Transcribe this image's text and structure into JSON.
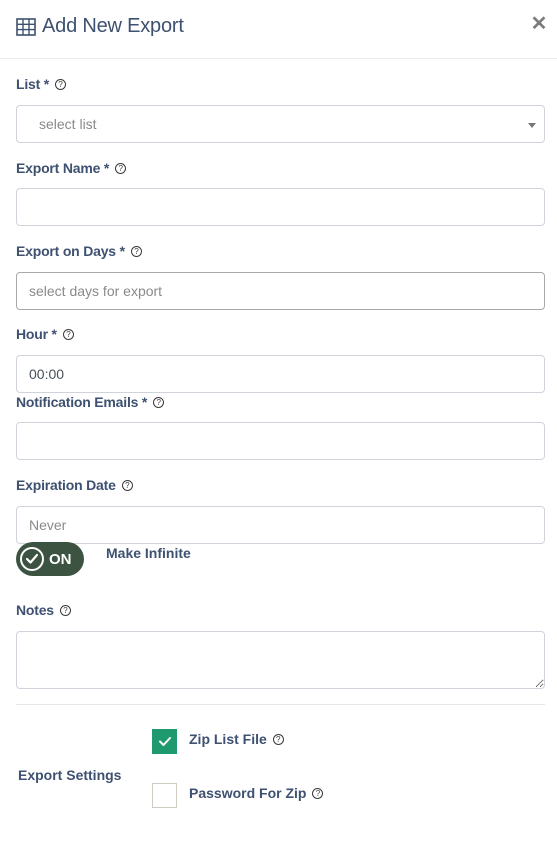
{
  "header": {
    "title": "Add New Export",
    "title_icon": "table-icon",
    "close_icon": "close-icon",
    "close_glyph": "✕"
  },
  "help_glyph": "?",
  "fields": {
    "list": {
      "label": "List *",
      "placeholder": "select list",
      "value": ""
    },
    "export_name": {
      "label": "Export Name *",
      "placeholder": "",
      "value": ""
    },
    "export_days": {
      "label": "Export on Days *",
      "placeholder": "select days for export",
      "value": ""
    },
    "hour": {
      "label": "Hour *",
      "value": "00:00"
    },
    "notification_emails": {
      "label": "Notification Emails *",
      "placeholder": "",
      "value": ""
    },
    "expiration_date": {
      "label": "Expiration Date",
      "placeholder": "Never",
      "value": ""
    },
    "make_infinite": {
      "toggle_text": "ON",
      "label": "Make Infinite",
      "state": "on"
    },
    "notes": {
      "label": "Notes",
      "value": ""
    }
  },
  "export_settings": {
    "label": "Export Settings",
    "options": [
      {
        "label": "Zip List File",
        "checked": true
      },
      {
        "label": "Password For Zip",
        "checked": false
      }
    ]
  },
  "colors": {
    "text": "#3e5170",
    "toggle_bg": "#3b5340",
    "checkbox_checked": "#1f9a6f"
  }
}
